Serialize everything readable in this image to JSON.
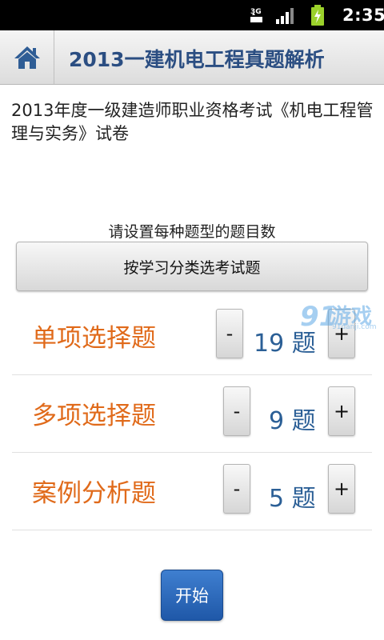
{
  "status_bar": {
    "network": "3G",
    "time": "2:35"
  },
  "header": {
    "title": "2013一建机电工程真题解析"
  },
  "exam_title": "2013年度一级建造师职业资格考试《机电工程管理与实务》试卷",
  "prompt": "请设置每种题型的题目数",
  "category_button_label": "按学习分类选考试题",
  "question_types": [
    {
      "label": "单项选择题",
      "count": "19",
      "unit": "题",
      "minus": "-",
      "plus": "+"
    },
    {
      "label": "多项选择题",
      "count": "9",
      "unit": "题",
      "minus": "-",
      "plus": "+"
    },
    {
      "label": "案例分析题",
      "count": "5",
      "unit": "题",
      "minus": "-",
      "plus": "+"
    }
  ],
  "start_button_label": "开始",
  "watermark": {
    "text": "游戏",
    "sub": "91danji.com"
  },
  "colors": {
    "title_blue": "#2b4e82",
    "label_orange": "#e06a1a",
    "count_blue": "#2b5f96",
    "start_button": "#2a68bb"
  }
}
